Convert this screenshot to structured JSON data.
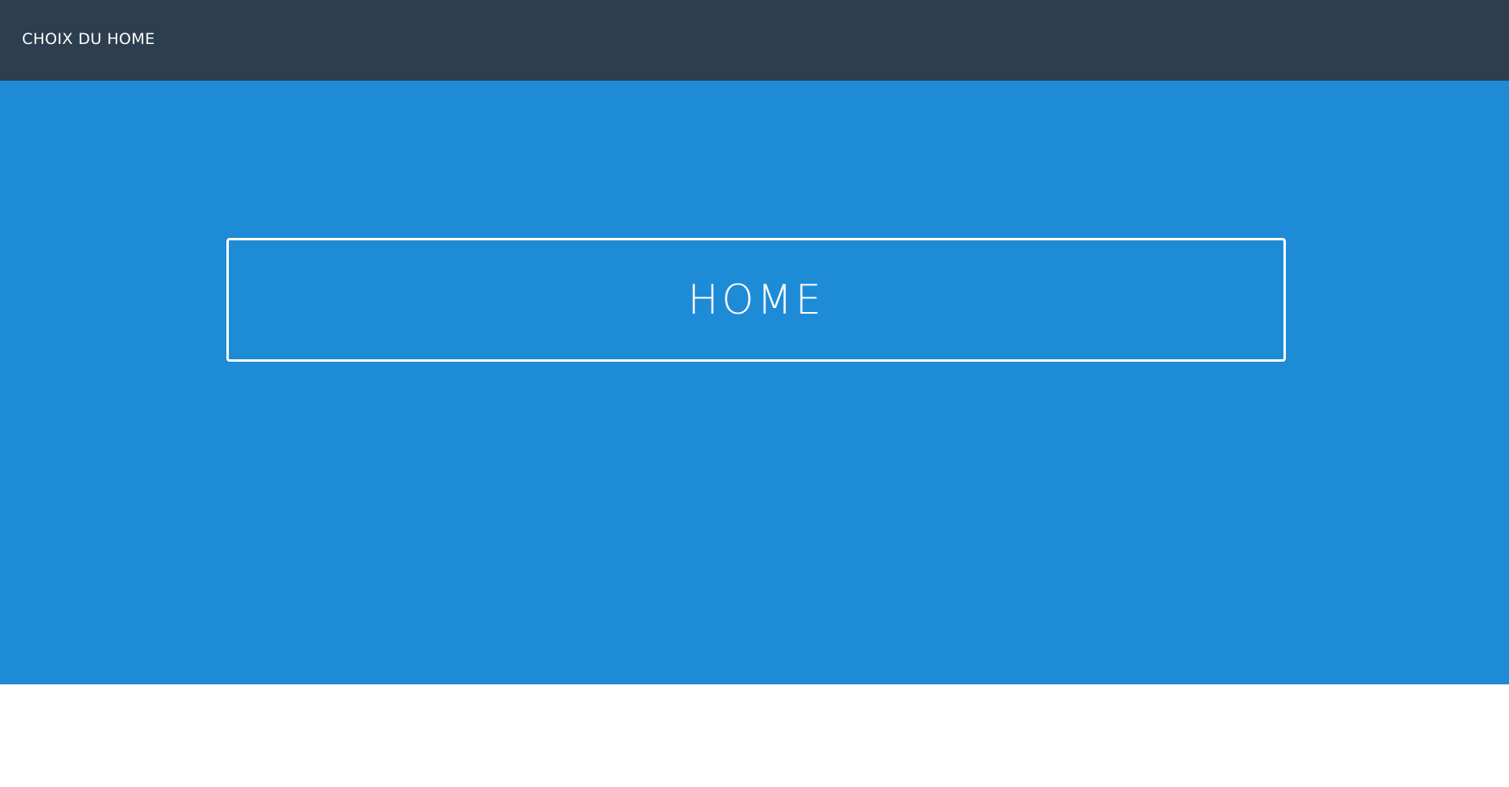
{
  "header": {
    "title": "CHOIX DU HOME"
  },
  "hero": {
    "home_button_label": "HOME"
  },
  "colors": {
    "header_bg": "#2d3e50",
    "hero_bg": "#1e8bd6",
    "text": "#ffffff",
    "page_bg": "#ffffff"
  }
}
